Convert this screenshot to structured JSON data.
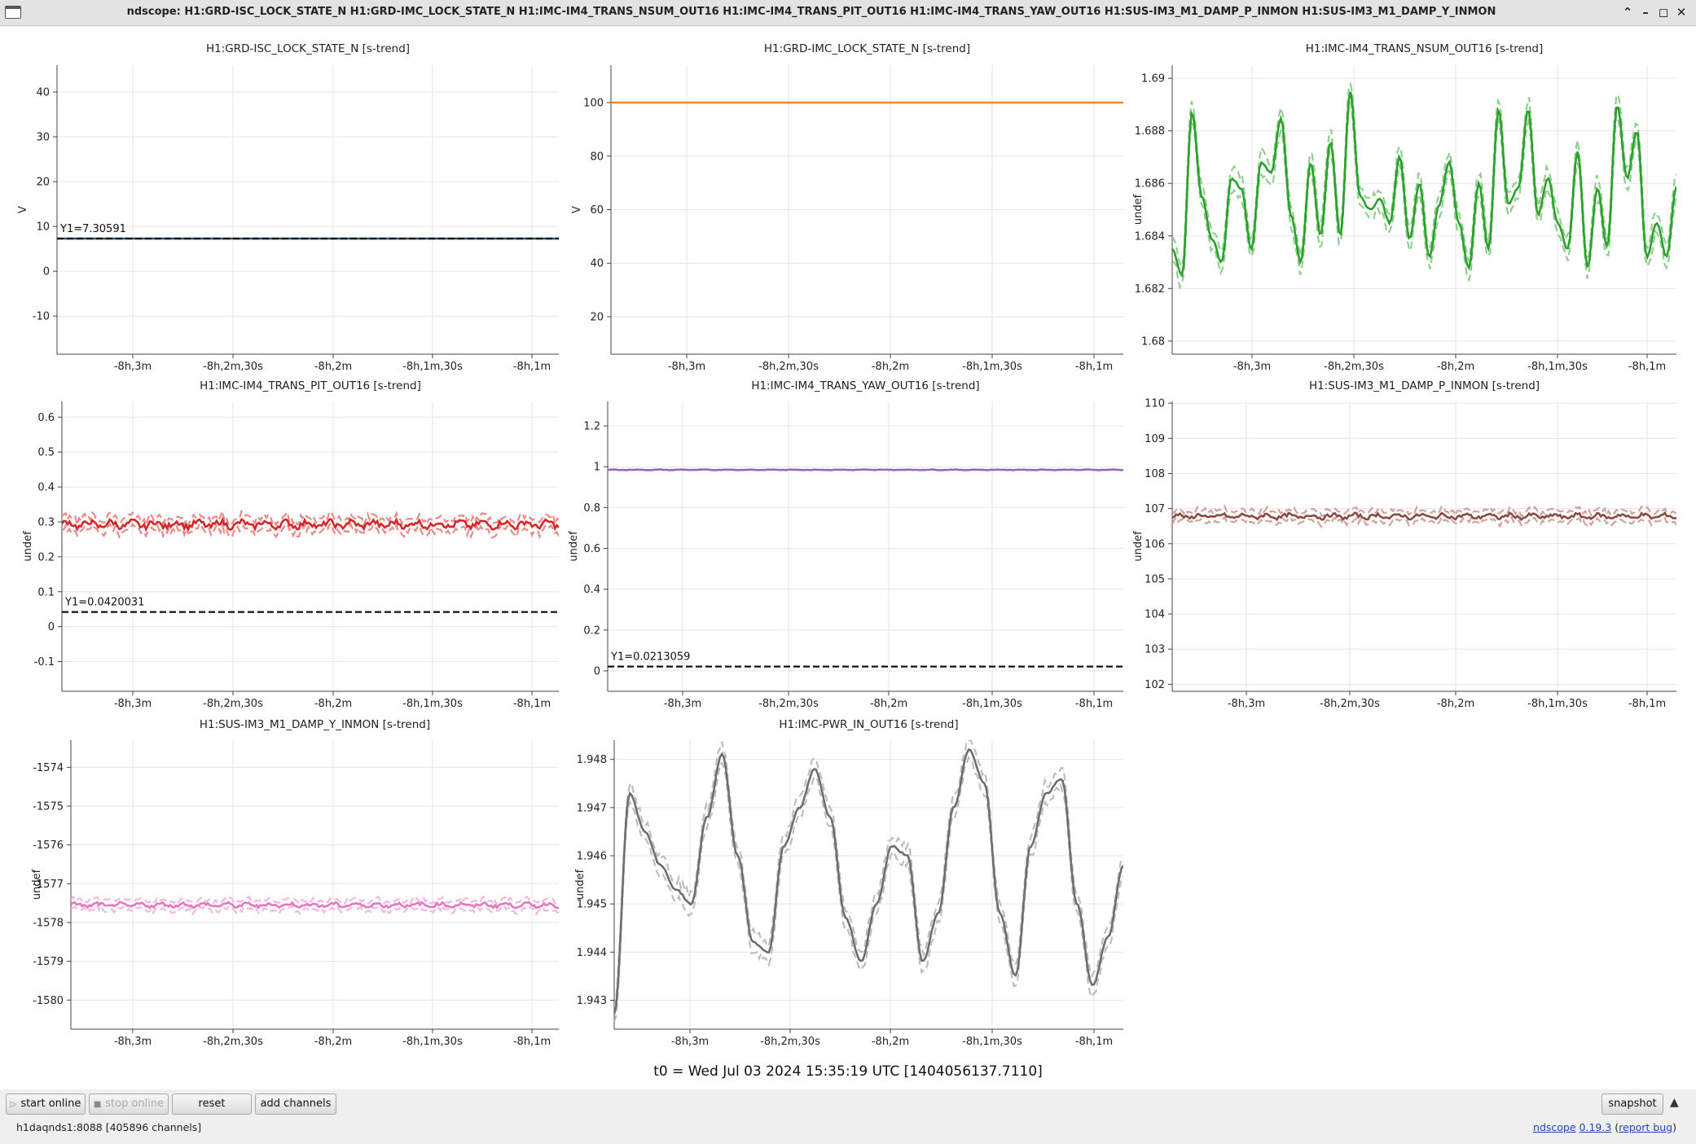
{
  "window": {
    "title": "ndscope: H1:GRD-ISC_LOCK_STATE_N H1:GRD-IMC_LOCK_STATE_N H1:IMC-IM4_TRANS_NSUM_OUT16 H1:IMC-IM4_TRANS_PIT_OUT16 H1:IMC-IM4_TRANS_YAW_OUT16 H1:SUS-IM3_M1_DAMP_P_INMON H1:SUS-IM3_M1_DAMP_Y_INMON",
    "minimize_glyph": "–",
    "maximize_glyph": "◻",
    "close_glyph": "✕",
    "menu_glyph": "⌃"
  },
  "time_axis": {
    "unit": "seconds relative to t0",
    "range": [
      -29425,
      -29455
    ]
  },
  "chart_data": [
    {
      "type": "line",
      "title": "H1:GRD-ISC_LOCK_STATE_N [s-trend]",
      "ylabel": "V",
      "ylim": [
        -18.5,
        46
      ],
      "yticks": [
        -10,
        0,
        10,
        20,
        30,
        40
      ],
      "xticks": [
        "-8h,3m",
        "-8h,2m,30s",
        "-8h,2m",
        "-8h,1m,30s",
        "-8h,1m"
      ],
      "series": [
        {
          "color": "#1f4e79",
          "shape": "flat",
          "value": 7.3,
          "noise": 0
        }
      ],
      "cursor": {
        "label": "Y1=7.30591",
        "value": 7.30591
      }
    },
    {
      "type": "line",
      "title": "H1:GRD-IMC_LOCK_STATE_N [s-trend]",
      "ylabel": "V",
      "ylim": [
        6,
        114
      ],
      "yticks": [
        20,
        40,
        60,
        80,
        100
      ],
      "xticks": [
        "-8h,3m",
        "-8h,2m,30s",
        "-8h,2m",
        "-8h,1m,30s",
        "-8h,1m"
      ],
      "series": [
        {
          "color": "#f08a24",
          "shape": "flat",
          "value": 100,
          "noise": 0
        }
      ]
    },
    {
      "type": "line",
      "title": "H1:IMC-IM4_TRANS_NSUM_OUT16 [s-trend]",
      "ylabel": "undef",
      "ylim": [
        1.6795,
        1.6905
      ],
      "yticks": [
        1.68,
        1.682,
        1.684,
        1.686,
        1.688,
        1.69
      ],
      "xticks": [
        "-8h,3m",
        "-8h,2m,30s",
        "-8h,2m",
        "-8h,1m,30s",
        "-8h,1m"
      ],
      "series": [
        {
          "color": "#2ca02c",
          "minmax_color": "#8fcf8f",
          "shape": "wave",
          "points": [
            1.6835,
            1.6825,
            1.6887,
            1.6855,
            1.6839,
            1.683,
            1.6862,
            1.6858,
            1.6835,
            1.6868,
            1.6864,
            1.6885,
            1.6848,
            1.683,
            1.6868,
            1.684,
            1.6876,
            1.684,
            1.6895,
            1.6855,
            1.685,
            1.6854,
            1.6845,
            1.687,
            1.6839,
            1.686,
            1.6832,
            1.6852,
            1.6868,
            1.6845,
            1.6828,
            1.686,
            1.6835,
            1.6888,
            1.6852,
            1.6858,
            1.6888,
            1.6848,
            1.6862,
            1.6845,
            1.6835,
            1.6872,
            1.6828,
            1.6858,
            1.6836,
            1.689,
            1.6862,
            1.688,
            1.6832,
            1.6845,
            1.6832,
            1.6859
          ],
          "minmax_spread": 0.0004
        }
      ]
    },
    {
      "type": "line",
      "title": "H1:IMC-IM4_TRANS_PIT_OUT16 [s-trend]",
      "ylabel": "undef",
      "ylim": [
        -0.185,
        0.645
      ],
      "yticks": [
        -0.1,
        0,
        0.1,
        0.2,
        0.3,
        0.4,
        0.5,
        0.6
      ],
      "xticks": [
        "-8h,3m",
        "-8h,2m,30s",
        "-8h,2m",
        "-8h,1m,30s",
        "-8h,1m"
      ],
      "series": [
        {
          "color": "#d62728",
          "minmax_color": "#e88a8a",
          "shape": "flat",
          "value": 0.293,
          "noise": 0.008
        }
      ],
      "cursor": {
        "label": "Y1=0.0420031",
        "value": 0.0420031
      }
    },
    {
      "type": "line",
      "title": "H1:IMC-IM4_TRANS_YAW_OUT16 [s-trend]",
      "ylabel": "undef",
      "ylim": [
        -0.1,
        1.32
      ],
      "yticks": [
        0,
        0.2,
        0.4,
        0.6,
        0.8,
        1,
        1.2
      ],
      "xticks": [
        "-8h,3m",
        "-8h,2m,30s",
        "-8h,2m",
        "-8h,1m,30s",
        "-8h,1m"
      ],
      "series": [
        {
          "color": "#9467bd",
          "shape": "flat",
          "value": 0.985,
          "noise": 0.001
        }
      ],
      "cursor": {
        "label": "Y1=0.0213059",
        "value": 0.0213059
      }
    },
    {
      "type": "line",
      "title": "H1:SUS-IM3_M1_DAMP_P_INMON [s-trend]",
      "ylabel": "undef",
      "ylim": [
        101.8,
        110.05
      ],
      "yticks": [
        102,
        103,
        104,
        105,
        106,
        107,
        108,
        109,
        110
      ],
      "xticks": [
        "-8h,3m",
        "-8h,2m,30s",
        "-8h,2m",
        "-8h,1m,30s",
        "-8h,1m"
      ],
      "series": [
        {
          "color": "#8c4a42",
          "minmax_color": "#cfa39e",
          "shape": "flat",
          "value": 106.78,
          "noise": 0.05,
          "minmax_spread": 0.15
        }
      ]
    },
    {
      "type": "line",
      "title": "H1:SUS-IM3_M1_DAMP_Y_INMON [s-trend]",
      "ylabel": "undef",
      "ylim": [
        -1580.75,
        -1573.3
      ],
      "yticks": [
        -1580,
        -1579,
        -1578,
        -1577,
        -1576,
        -1575,
        -1574
      ],
      "xticks": [
        "-8h,3m",
        "-8h,2m,30s",
        "-8h,2m",
        "-8h,1m,30s",
        "-8h,1m"
      ],
      "series": [
        {
          "color": "#e377c2",
          "minmax_color": "#f3b8df",
          "shape": "flat",
          "value": -1577.55,
          "noise": 0.04,
          "minmax_spread": 0.12
        }
      ]
    },
    {
      "type": "line",
      "title": "H1:IMC-PWR_IN_OUT16 [s-trend]",
      "ylabel": "undef",
      "ylim": [
        1.9424,
        1.9484
      ],
      "yticks": [
        1.943,
        1.944,
        1.945,
        1.946,
        1.947,
        1.948
      ],
      "xticks": [
        "-8h,3m",
        "-8h,2m,30s",
        "-8h,2m",
        "-8h,1m,30s",
        "-8h,1m"
      ],
      "series": [
        {
          "color": "#6e6e6e",
          "minmax_color": "#bdbdbd",
          "shape": "wave",
          "points": [
            1.9427,
            1.9473,
            1.9465,
            1.9458,
            1.9453,
            1.945,
            1.9468,
            1.9481,
            1.946,
            1.9442,
            1.944,
            1.9462,
            1.947,
            1.9478,
            1.9468,
            1.9447,
            1.9438,
            1.945,
            1.9462,
            1.946,
            1.9438,
            1.9448,
            1.947,
            1.9482,
            1.9475,
            1.9448,
            1.9435,
            1.9462,
            1.9473,
            1.9476,
            1.945,
            1.9433,
            1.9443,
            1.9458
          ],
          "minmax_spread": 0.0002
        }
      ]
    }
  ],
  "t0_label": "t0 = Wed Jul 03 2024 15:35:19 UTC [1404056137.7110]",
  "buttons": {
    "start_online": "start online",
    "stop_online": "stop online",
    "reset": "reset",
    "add_channels": "add channels",
    "snapshot": "snapshot"
  },
  "status": {
    "server": "h1daqnds1:8088  [405896 channels]",
    "app_name": "ndscope",
    "version": "0.19.3",
    "report_bug": "report bug"
  }
}
